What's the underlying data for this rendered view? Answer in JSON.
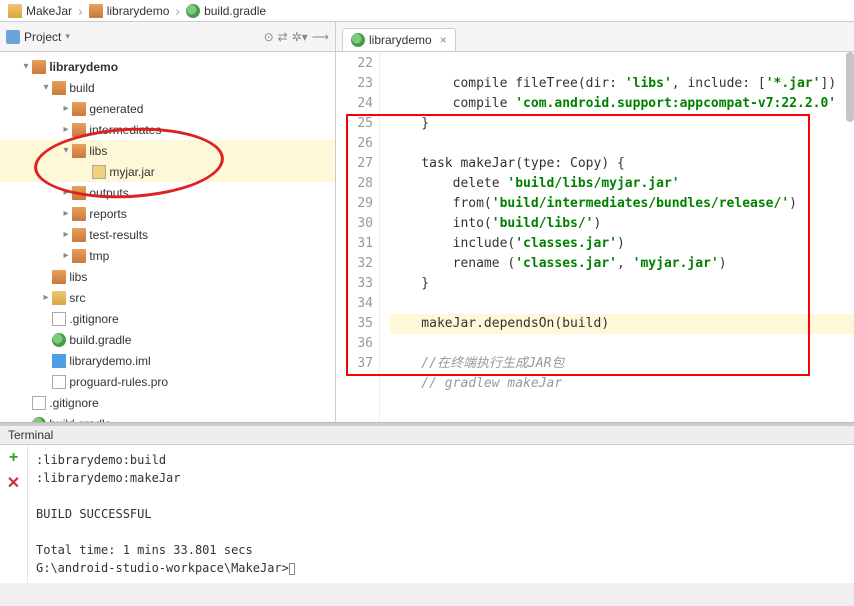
{
  "breadcrumb": {
    "c1": "MakeJar",
    "c2": "librarydemo",
    "c3": "build.gradle"
  },
  "projectPanel": {
    "title": "Project"
  },
  "tree": {
    "root": "librarydemo",
    "build": "build",
    "generated": "generated",
    "intermediates": "intermediates",
    "libs": "libs",
    "myjar": "myjar.jar",
    "outputs": "outputs",
    "reports": "reports",
    "testresults": "test-results",
    "tmp": "tmp",
    "libs2": "libs",
    "src": "src",
    "gitignore": ".gitignore",
    "buildgradle": "build.gradle",
    "iml": "librarydemo.iml",
    "proguard": "proguard-rules.pro",
    "gitignore2": ".gitignore",
    "buildgradle2": "build.gradle"
  },
  "tab": {
    "label": "librarydemo",
    "close": "×"
  },
  "code": {
    "l22": "        compile fileTree(dir: 'libs', include: ['*.jar'])",
    "l23": "        compile 'com.android.support:appcompat-v7:22.2.0'",
    "l24": "    }",
    "l25": "",
    "l26": "    task makeJar(type: Copy) {",
    "l27": "        delete 'build/libs/myjar.jar'",
    "l28": "        from('build/intermediates/bundles/release/')",
    "l29": "        into('build/libs/')",
    "l30": "        include('classes.jar')",
    "l31": "        rename ('classes.jar', 'myjar.jar')",
    "l32": "    }",
    "l33": "",
    "l34": "    makeJar.dependsOn(build)",
    "l35": "    //在终端执行生成JAR包",
    "l36": "    // gradlew makeJar",
    "l37": ""
  },
  "terminal": {
    "title": "Terminal",
    "l1": ":librarydemo:build",
    "l2": ":librarydemo:makeJar",
    "l3": "",
    "l4": "BUILD SUCCESSFUL",
    "l5": "",
    "l6": "Total time: 1 mins 33.801 secs",
    "prompt": "G:\\android-studio-workpace\\MakeJar>"
  },
  "lineNumbers": {
    "n22": "22",
    "n23": "23",
    "n24": "24",
    "n25": "25",
    "n26": "26",
    "n27": "27",
    "n28": "28",
    "n29": "29",
    "n30": "30",
    "n31": "31",
    "n32": "32",
    "n33": "33",
    "n34": "34",
    "n35": "35",
    "n36": "36",
    "n37": "37"
  }
}
